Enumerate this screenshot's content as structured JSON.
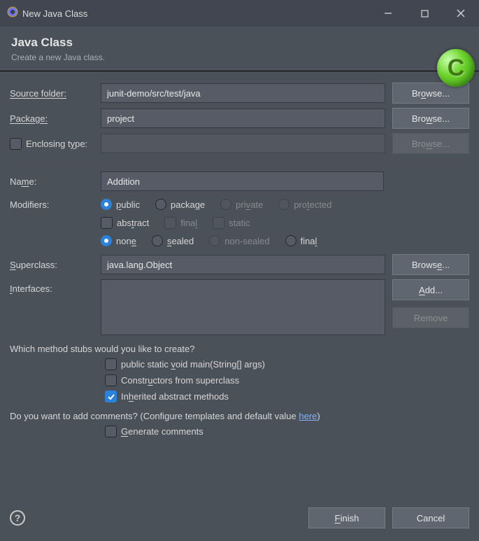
{
  "window": {
    "title": "New Java Class",
    "minimize": "—",
    "maximize": "□",
    "close": "✕"
  },
  "banner": {
    "title": "Java Class",
    "subtitle": "Create a new Java class.",
    "iconLetter": "C"
  },
  "fields": {
    "sourceFolder": {
      "label": "Source folder:",
      "value": "junit-demo/src/test/java",
      "browse": "Browse..."
    },
    "package": {
      "label": "Package:",
      "value": "project",
      "browse": "Browse..."
    },
    "enclosing": {
      "label": "Enclosing type:",
      "value": "",
      "browse": "Browse...",
      "checked": false
    },
    "name": {
      "label": "Name:",
      "value": "Addition"
    },
    "modifiers": {
      "label": "Modifiers:"
    },
    "superclass": {
      "label": "Superclass:",
      "value": "java.lang.Object",
      "browse": "Browse..."
    },
    "interfaces": {
      "label": "Interfaces:",
      "add": "Add...",
      "remove": "Remove"
    }
  },
  "modifiers": {
    "visibility": {
      "public": {
        "label": "public",
        "selected": true
      },
      "package": {
        "label": "package",
        "selected": false
      },
      "private": {
        "label": "private",
        "selected": false,
        "disabled": true
      },
      "protected": {
        "label": "protected",
        "selected": false,
        "disabled": true
      }
    },
    "flags": {
      "abstract": {
        "label": "abstract",
        "checked": false
      },
      "final": {
        "label": "final",
        "checked": false,
        "disabled": true
      },
      "static": {
        "label": "static",
        "checked": false,
        "disabled": true
      }
    },
    "sealed": {
      "none": {
        "label": "none",
        "selected": true
      },
      "sealed": {
        "label": "sealed",
        "selected": false
      },
      "nonsealed": {
        "label": "non-sealed",
        "selected": false,
        "disabled": true
      },
      "final": {
        "label": "final",
        "selected": false
      }
    }
  },
  "stubs": {
    "question": "Which method stubs would you like to create?",
    "main": {
      "label": "public static void main(String[] args)",
      "checked": false
    },
    "ctors": {
      "label": "Constructors from superclass",
      "checked": false
    },
    "inherited": {
      "label": "Inherited abstract methods",
      "checked": true
    }
  },
  "comments": {
    "question_pre": "Do you want to add comments? (Configure templates and default value ",
    "link": "here",
    "question_post": ")",
    "generate": {
      "label": "Generate comments",
      "checked": false
    }
  },
  "footer": {
    "help": "?",
    "finish": "Finish",
    "cancel": "Cancel"
  }
}
